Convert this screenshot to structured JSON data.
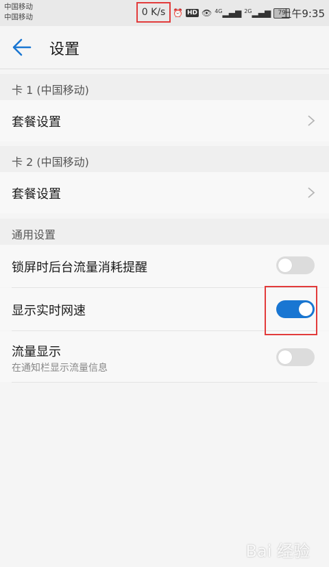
{
  "statusbar": {
    "carrier1": "中国移动",
    "carrier2": "中国移动",
    "net_speed": "0 K/s",
    "hd": "HD",
    "net1": "4G",
    "net2": "2G",
    "battery": "79",
    "time": "上午9:35"
  },
  "appbar": {
    "title": "设置"
  },
  "sections": {
    "card1_header": "卡 1 (中国移动)",
    "card1_plan": "套餐设置",
    "card2_header": "卡 2 (中国移动)",
    "card2_plan": "套餐设置",
    "general_header": "通用设置",
    "lock_alert": "锁屏时后台流量消耗提醒",
    "realtime_speed": "显示实时网速",
    "traffic_display": "流量显示",
    "traffic_display_sub": "在通知栏显示流量信息"
  },
  "toggles": {
    "lock_alert": false,
    "realtime_speed": true,
    "traffic_display": false
  },
  "watermark": "Bai 经验",
  "colors": {
    "accent": "#1976d2",
    "highlight": "#e23a3a"
  }
}
